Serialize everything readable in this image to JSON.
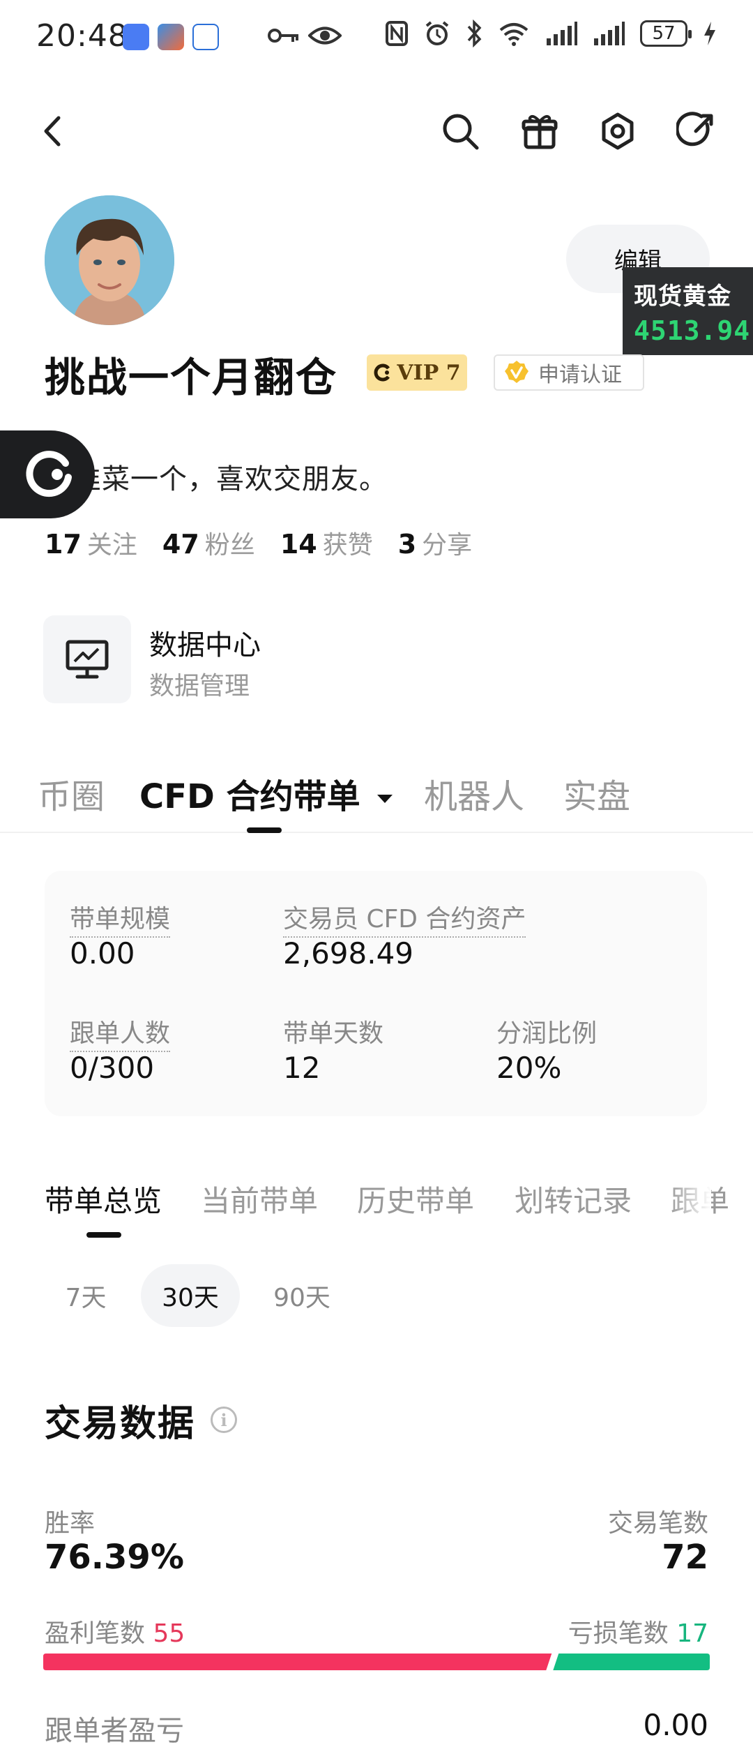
{
  "status_bar": {
    "time": "20:48",
    "battery": "57",
    "icons": [
      "key-icon",
      "eye-icon",
      "nfc-icon",
      "alarm-icon",
      "bluetooth-icon",
      "wifi-icon",
      "signal-icon",
      "signal-icon",
      "battery-icon",
      "charging-icon"
    ]
  },
  "header": {
    "icons": [
      "back-icon",
      "search-icon",
      "gift-icon",
      "settings-icon",
      "share-icon"
    ]
  },
  "profile": {
    "edit_label": "编辑",
    "username": "挑战一个月翻仓",
    "vip_label": "VIP 7",
    "verify_label": "申请认证",
    "bio": "老韭菜一个，喜欢交朋友。",
    "stats": [
      {
        "num": "17",
        "label": "关注"
      },
      {
        "num": "47",
        "label": "粉丝"
      },
      {
        "num": "14",
        "label": "获赞"
      },
      {
        "num": "3",
        "label": "分享"
      }
    ]
  },
  "gold_widget": {
    "title": "现货黄金",
    "price": "4513.94",
    "price_color": "#2ed573"
  },
  "data_center": {
    "title": "数据中心",
    "subtitle": "数据管理"
  },
  "main_tabs": [
    {
      "label": "币圈",
      "active": false
    },
    {
      "label": "CFD 合约带单",
      "active": true
    },
    {
      "label": "机器人",
      "active": false
    },
    {
      "label": "实盘",
      "active": false
    }
  ],
  "summary_card": {
    "scale_label": "带单规模",
    "scale_value": "0.00",
    "assets_label": "交易员 CFD 合约资产",
    "assets_value": "2,698.49",
    "followers_label": "跟单人数",
    "followers_value": "0/300",
    "days_label": "带单天数",
    "days_value": "12",
    "share_label": "分润比例",
    "share_value": "20%"
  },
  "sub_tabs": [
    "带单总览",
    "当前带单",
    "历史带单",
    "划转记录",
    "跟单"
  ],
  "periods": [
    {
      "label": "7天",
      "active": false
    },
    {
      "label": "30天",
      "active": true
    },
    {
      "label": "90天",
      "active": false
    }
  ],
  "trading": {
    "title": "交易数据",
    "win_rate_label": "胜率",
    "win_rate": "76.39%",
    "trades_label": "交易笔数",
    "trades": "72",
    "profit_label": "盈利笔数",
    "profit_count": "55",
    "loss_label": "亏损笔数",
    "loss_count": "17",
    "profit_color": "#f4335f",
    "loss_color": "#13be82",
    "follower_pnl_label": "跟单者盈亏",
    "follower_pnl": "0.00"
  }
}
